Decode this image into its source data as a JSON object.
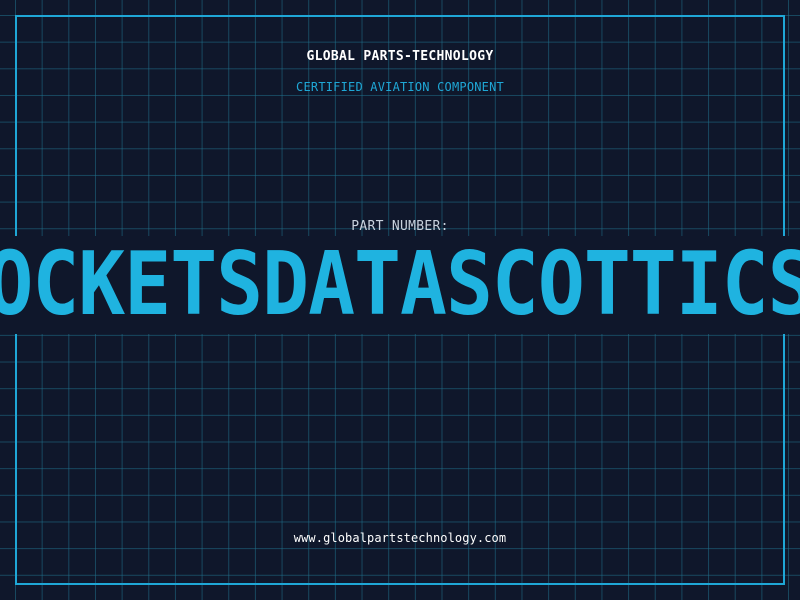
{
  "header": {
    "company": "GLOBAL PARTS-TECHNOLOGY",
    "subtitle": "CERTIFIED AVIATION COMPONENT"
  },
  "part": {
    "label": "PART NUMBER:",
    "number": "OCKETSDATASCOTTICS"
  },
  "footer": {
    "website": "www.globalpartstechnology.com"
  },
  "colors": {
    "background": "#0f172b",
    "grid": "#1f718c",
    "accent": "#1fa7d6",
    "text": "#ffffff",
    "muted": "#c9d2de"
  }
}
